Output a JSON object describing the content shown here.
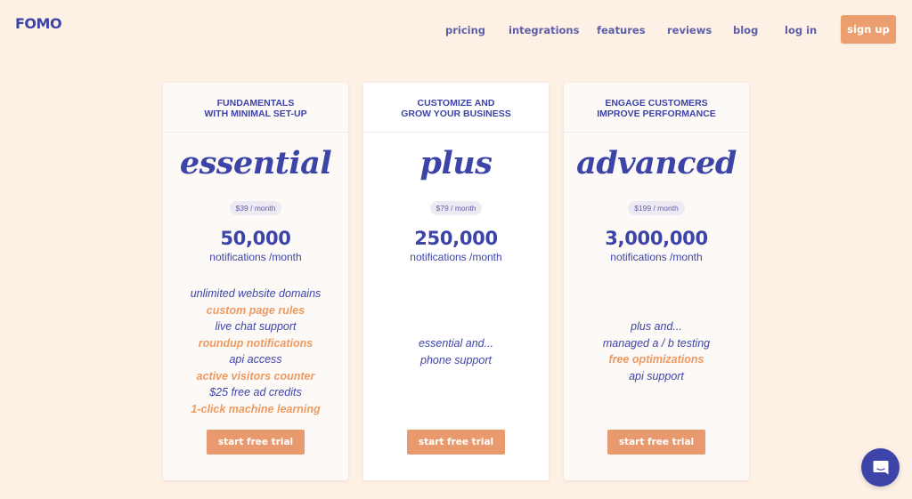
{
  "brand": {
    "logo": "FOMO",
    "accent": "#3d44a8",
    "orange": "#eb9f6e"
  },
  "nav": {
    "items": [
      {
        "label": "pricing"
      },
      {
        "label": "integrations"
      },
      {
        "label": "features"
      },
      {
        "label": "reviews"
      },
      {
        "label": "blog"
      },
      {
        "label": "log in"
      }
    ],
    "signup_label": "sign up"
  },
  "plans": [
    {
      "tagline": "FUNDAMENTALS\nWITH MINIMAL SET-UP",
      "name": "essential",
      "price": "$39 / month",
      "count": "50,000",
      "unit": "notifications /month",
      "features": [
        {
          "text": "unlimited website domains",
          "highlight": false
        },
        {
          "text": "custom page rules",
          "highlight": true
        },
        {
          "text": "live chat support",
          "highlight": false
        },
        {
          "text": "roundup notifications",
          "highlight": true
        },
        {
          "text": "api access",
          "highlight": false
        },
        {
          "text": "active visitors counter",
          "highlight": true
        },
        {
          "text": "$25 free ad credits",
          "highlight": false
        },
        {
          "text": "1-click machine learning",
          "highlight": true
        }
      ],
      "cta": "start free trial"
    },
    {
      "tagline": "CUSTOMIZE AND\nGROW YOUR BUSINESS",
      "name": "plus",
      "price": "$79 / month",
      "count": "250,000",
      "unit": "notifications /month",
      "features": [
        {
          "text": "essential and...",
          "highlight": false
        },
        {
          "text": "phone support",
          "highlight": false
        }
      ],
      "cta": "start free trial"
    },
    {
      "tagline": "ENGAGE CUSTOMERS\nIMPROVE PERFORMANCE",
      "name": "advanced",
      "price": "$199 / month",
      "count": "3,000,000",
      "unit": "notifications /month",
      "features": [
        {
          "text": "plus and...",
          "highlight": false
        },
        {
          "text": "managed a / b testing",
          "highlight": false
        },
        {
          "text": "free optimizations",
          "highlight": true
        },
        {
          "text": "api support",
          "highlight": false
        }
      ],
      "cta": "start free trial"
    }
  ],
  "chat": {
    "icon": "chat-bubble-icon"
  }
}
